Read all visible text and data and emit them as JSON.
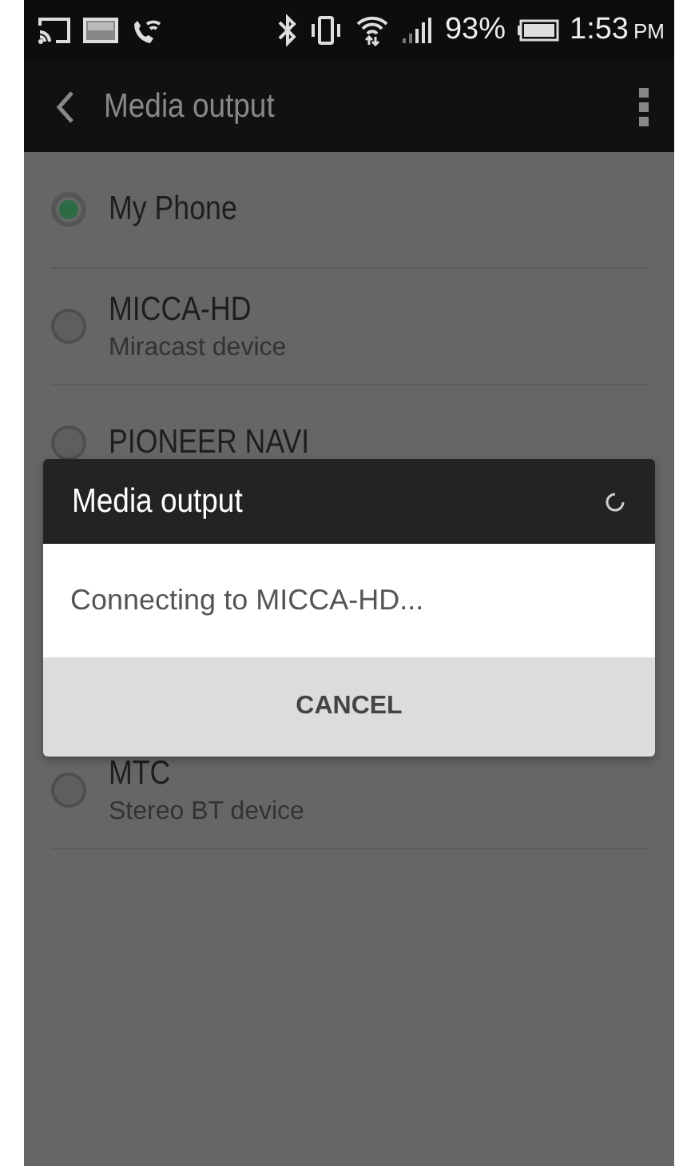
{
  "status_bar": {
    "battery": "93%",
    "time": "1:53",
    "ampm": "PM"
  },
  "app_bar": {
    "title": "Media output"
  },
  "devices": [
    {
      "name": "My Phone",
      "selected": true
    },
    {
      "name": "MICCA-HD",
      "subtitle": "Miracast device",
      "selected": false
    },
    {
      "name": "PIONEER NAVI",
      "selected": false
    },
    {
      "name": "MTC",
      "subtitle": "Stereo BT device",
      "selected": false
    }
  ],
  "dialog": {
    "title": "Media output",
    "message": "Connecting to MICCA-HD...",
    "buttons": [
      "CANCEL"
    ]
  }
}
